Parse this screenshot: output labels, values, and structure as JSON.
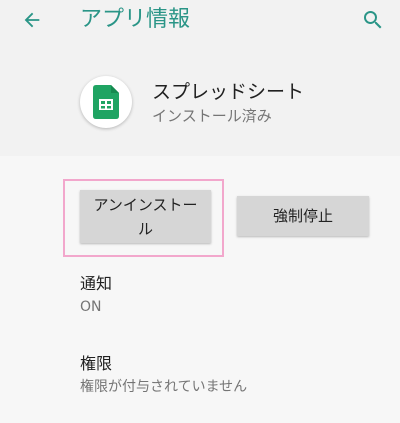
{
  "toolbar": {
    "title": "アプリ情報",
    "back_icon": "arrow-back-icon",
    "search_icon": "search-icon"
  },
  "app": {
    "name": "スプレッドシート",
    "status": "インストール済み",
    "icon": "sheets-app-icon",
    "icon_color": "#1fa463"
  },
  "actions": {
    "uninstall_label": "アンインストール",
    "force_stop_label": "強制停止"
  },
  "settings": {
    "notifications": {
      "title": "通知",
      "summary": "ON"
    },
    "permissions": {
      "title": "権限",
      "summary": "権限が付与されていません"
    }
  },
  "colors": {
    "accent": "#2a9587",
    "highlight": "#f2a7cc"
  }
}
